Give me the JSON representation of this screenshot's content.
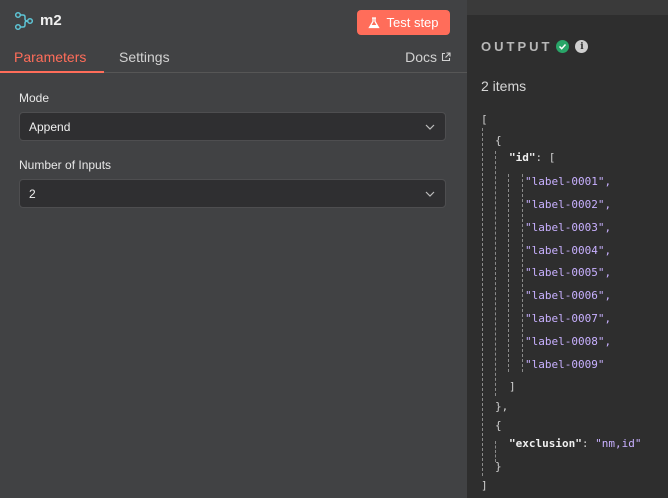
{
  "header": {
    "title": "m2",
    "test_button": "Test step"
  },
  "tabs": [
    {
      "label": "Parameters"
    },
    {
      "label": "Settings"
    }
  ],
  "docs_label": "Docs",
  "fields": {
    "mode": {
      "label": "Mode",
      "value": "Append"
    },
    "inputs": {
      "label": "Number of Inputs",
      "value": "2"
    }
  },
  "output": {
    "title": "OUTPUT",
    "items_count": "2 items",
    "json": {
      "open_array": "[",
      "obj1_open": "{",
      "id_key": "\"id\"",
      "id_colon": ": [",
      "labels": [
        "\"label-0001\",",
        "\"label-0002\",",
        "\"label-0003\",",
        "\"label-0004\",",
        "\"label-0005\",",
        "\"label-0006\",",
        "\"label-0007\",",
        "\"label-0008\",",
        "\"label-0009\""
      ],
      "id_close": "]",
      "obj1_close": "},",
      "obj2_open": "{",
      "excl_key": "\"exclusion\"",
      "excl_colon": ":",
      "excl_value": "\"nm,id\"",
      "obj2_close": "}",
      "close_array": "]"
    }
  },
  "colors": {
    "accent": "#ff6d5a",
    "success": "#29a568",
    "string": "#c8b0ff"
  },
  "icons": {
    "node": "merge-node-icon",
    "flask": "flask-icon",
    "external": "external-link-icon",
    "chevron": "chevron-down-icon",
    "status": "check-circle-icon",
    "info": "info-icon"
  }
}
